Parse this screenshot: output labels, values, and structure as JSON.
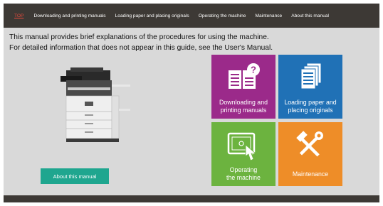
{
  "nav": {
    "items": [
      "TOP",
      "Downloading and printing manuals",
      "Loading paper and placing originals",
      "Operating the machine",
      "Maintenance",
      "About this manual"
    ]
  },
  "intro": {
    "line1": "This manual provides brief explanations of the procedures for using the machine.",
    "line2": "For detailed information that does not appear in this guide, see the User's Manual."
  },
  "about_button": "About this manual",
  "tiles": [
    {
      "line1": "Downloading and",
      "line2": "printing manuals",
      "color": "#9b2a8a",
      "icon": "document-question-icon"
    },
    {
      "line1": "Loading paper and",
      "line2": "placing originals",
      "color": "#2071b6",
      "icon": "paper-stack-icon"
    },
    {
      "line1": "Operating",
      "line2": "the machine",
      "color": "#6cb33f",
      "icon": "touch-screen-icon"
    },
    {
      "line1": "Maintenance",
      "line2": "",
      "color": "#ee8d28",
      "icon": "hammer-wrench-icon"
    }
  ]
}
